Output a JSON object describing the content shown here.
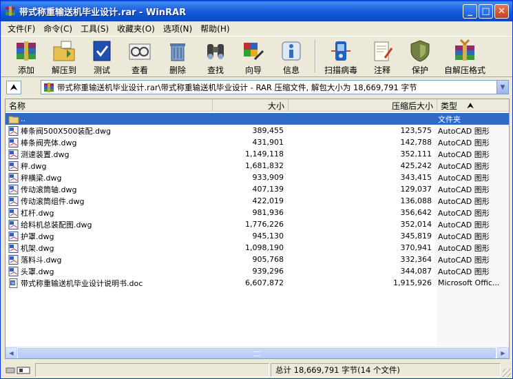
{
  "window": {
    "title": "带式称重输送机毕业设计.rar - WinRAR",
    "minimize_glyph": "_",
    "maximize_glyph": "□",
    "close_glyph": "✕"
  },
  "menu": [
    {
      "label": "文件(F)"
    },
    {
      "label": "命令(C)"
    },
    {
      "label": "工具(S)"
    },
    {
      "label": "收藏夹(O)"
    },
    {
      "label": "选项(N)"
    },
    {
      "label": "帮助(H)"
    }
  ],
  "toolbar": [
    {
      "label": "添加",
      "icon": "add-icon",
      "color": "#8b2d6b"
    },
    {
      "label": "解压到",
      "icon": "extract-to-icon",
      "color": "#d8a020"
    },
    {
      "label": "测试",
      "icon": "test-icon",
      "color": "#2050b0"
    },
    {
      "label": "查看",
      "icon": "view-icon",
      "color": "#808080"
    },
    {
      "label": "删除",
      "icon": "delete-icon",
      "color": "#3060a0"
    },
    {
      "label": "查找",
      "icon": "find-icon",
      "color": "#404040"
    },
    {
      "label": "向导",
      "icon": "wizard-icon",
      "color": "#c03030"
    },
    {
      "label": "信息",
      "icon": "info-icon",
      "color": "#3070c0"
    },
    {
      "label": "扫描病毒",
      "icon": "virus-scan-icon",
      "color": "#2060c0"
    },
    {
      "label": "注释",
      "icon": "comment-icon",
      "color": "#e0e0d0"
    },
    {
      "label": "保护",
      "icon": "protect-icon",
      "color": "#708040"
    },
    {
      "label": "自解压格式",
      "icon": "sfx-icon",
      "color": "#c08020"
    }
  ],
  "address": {
    "up_glyph": "⮝",
    "path": "带式称重输送机毕业设计.rar\\带式称重输送机毕业设计 - RAR 压缩文件, 解包大小为 18,669,791 字节",
    "dropdown_glyph": "▼"
  },
  "columns": {
    "name": "名称",
    "size": "大小",
    "packed": "压缩后大小",
    "type": "类型",
    "sort_glyph": "⮝"
  },
  "files": [
    {
      "name": "..",
      "size": "",
      "packed": "",
      "type": "文件夹",
      "icon": "folder-icon",
      "selected": true
    },
    {
      "name": "棒条阀500X500装配.dwg",
      "size": "389,455",
      "packed": "123,575",
      "type": "AutoCAD 图形",
      "icon": "dwg-file-icon"
    },
    {
      "name": "棒条阀壳体.dwg",
      "size": "431,901",
      "packed": "142,788",
      "type": "AutoCAD 图形",
      "icon": "dwg-file-icon"
    },
    {
      "name": "测速装置.dwg",
      "size": "1,149,118",
      "packed": "352,111",
      "type": "AutoCAD 图形",
      "icon": "dwg-file-icon"
    },
    {
      "name": "秤.dwg",
      "size": "1,681,832",
      "packed": "425,242",
      "type": "AutoCAD 图形",
      "icon": "dwg-file-icon"
    },
    {
      "name": "秤横梁.dwg",
      "size": "933,909",
      "packed": "343,415",
      "type": "AutoCAD 图形",
      "icon": "dwg-file-icon"
    },
    {
      "name": "传动滚筒轴.dwg",
      "size": "407,139",
      "packed": "129,037",
      "type": "AutoCAD 图形",
      "icon": "dwg-file-icon"
    },
    {
      "name": "传动滚筒组件.dwg",
      "size": "422,019",
      "packed": "136,088",
      "type": "AutoCAD 图形",
      "icon": "dwg-file-icon"
    },
    {
      "name": "杠杆.dwg",
      "size": "981,936",
      "packed": "356,642",
      "type": "AutoCAD 图形",
      "icon": "dwg-file-icon"
    },
    {
      "name": "给料机总装配图.dwg",
      "size": "1,776,226",
      "packed": "352,014",
      "type": "AutoCAD 图形",
      "icon": "dwg-file-icon"
    },
    {
      "name": "护罩.dwg",
      "size": "945,130",
      "packed": "345,819",
      "type": "AutoCAD 图形",
      "icon": "dwg-file-icon"
    },
    {
      "name": "机架.dwg",
      "size": "1,098,190",
      "packed": "370,941",
      "type": "AutoCAD 图形",
      "icon": "dwg-file-icon"
    },
    {
      "name": "落料斗.dwg",
      "size": "905,768",
      "packed": "332,364",
      "type": "AutoCAD 图形",
      "icon": "dwg-file-icon"
    },
    {
      "name": "头罩.dwg",
      "size": "939,296",
      "packed": "344,087",
      "type": "AutoCAD 图形",
      "icon": "dwg-file-icon"
    },
    {
      "name": "带式称重输送机毕业设计说明书.doc",
      "size": "6,607,872",
      "packed": "1,915,926",
      "type": "Microsoft Offic...",
      "icon": "word-doc-icon"
    }
  ],
  "scrollbar": {
    "left_glyph": "◀",
    "right_glyph": "▶"
  },
  "status": {
    "total": "总计 18,669,791 字节(14 个文件)"
  }
}
